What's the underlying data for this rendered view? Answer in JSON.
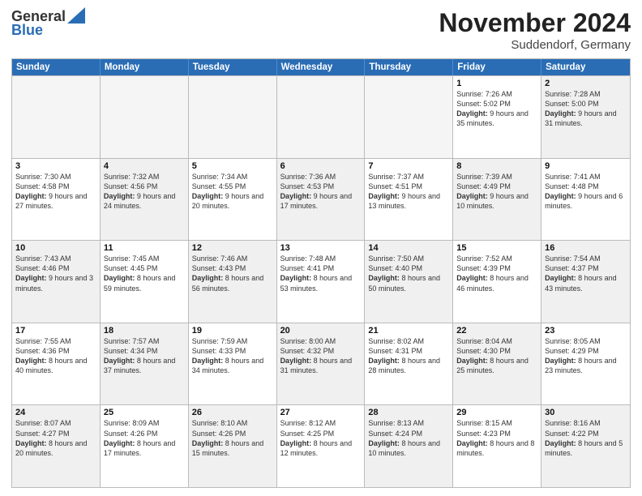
{
  "header": {
    "logo_general": "General",
    "logo_blue": "Blue",
    "month_title": "November 2024",
    "location": "Suddendorf, Germany"
  },
  "weekdays": [
    "Sunday",
    "Monday",
    "Tuesday",
    "Wednesday",
    "Thursday",
    "Friday",
    "Saturday"
  ],
  "rows": [
    [
      {
        "day": "",
        "info": "",
        "empty": true
      },
      {
        "day": "",
        "info": "",
        "empty": true
      },
      {
        "day": "",
        "info": "",
        "empty": true
      },
      {
        "day": "",
        "info": "",
        "empty": true
      },
      {
        "day": "",
        "info": "",
        "empty": true
      },
      {
        "day": "1",
        "info": "Sunrise: 7:26 AM\nSunset: 5:02 PM\nDaylight: 9 hours and 35 minutes."
      },
      {
        "day": "2",
        "info": "Sunrise: 7:28 AM\nSunset: 5:00 PM\nDaylight: 9 hours and 31 minutes.",
        "shaded": true
      }
    ],
    [
      {
        "day": "3",
        "info": "Sunrise: 7:30 AM\nSunset: 4:58 PM\nDaylight: 9 hours and 27 minutes."
      },
      {
        "day": "4",
        "info": "Sunrise: 7:32 AM\nSunset: 4:56 PM\nDaylight: 9 hours and 24 minutes.",
        "shaded": true
      },
      {
        "day": "5",
        "info": "Sunrise: 7:34 AM\nSunset: 4:55 PM\nDaylight: 9 hours and 20 minutes."
      },
      {
        "day": "6",
        "info": "Sunrise: 7:36 AM\nSunset: 4:53 PM\nDaylight: 9 hours and 17 minutes.",
        "shaded": true
      },
      {
        "day": "7",
        "info": "Sunrise: 7:37 AM\nSunset: 4:51 PM\nDaylight: 9 hours and 13 minutes."
      },
      {
        "day": "8",
        "info": "Sunrise: 7:39 AM\nSunset: 4:49 PM\nDaylight: 9 hours and 10 minutes.",
        "shaded": true
      },
      {
        "day": "9",
        "info": "Sunrise: 7:41 AM\nSunset: 4:48 PM\nDaylight: 9 hours and 6 minutes."
      }
    ],
    [
      {
        "day": "10",
        "info": "Sunrise: 7:43 AM\nSunset: 4:46 PM\nDaylight: 9 hours and 3 minutes.",
        "shaded": true
      },
      {
        "day": "11",
        "info": "Sunrise: 7:45 AM\nSunset: 4:45 PM\nDaylight: 8 hours and 59 minutes."
      },
      {
        "day": "12",
        "info": "Sunrise: 7:46 AM\nSunset: 4:43 PM\nDaylight: 8 hours and 56 minutes.",
        "shaded": true
      },
      {
        "day": "13",
        "info": "Sunrise: 7:48 AM\nSunset: 4:41 PM\nDaylight: 8 hours and 53 minutes."
      },
      {
        "day": "14",
        "info": "Sunrise: 7:50 AM\nSunset: 4:40 PM\nDaylight: 8 hours and 50 minutes.",
        "shaded": true
      },
      {
        "day": "15",
        "info": "Sunrise: 7:52 AM\nSunset: 4:39 PM\nDaylight: 8 hours and 46 minutes."
      },
      {
        "day": "16",
        "info": "Sunrise: 7:54 AM\nSunset: 4:37 PM\nDaylight: 8 hours and 43 minutes.",
        "shaded": true
      }
    ],
    [
      {
        "day": "17",
        "info": "Sunrise: 7:55 AM\nSunset: 4:36 PM\nDaylight: 8 hours and 40 minutes."
      },
      {
        "day": "18",
        "info": "Sunrise: 7:57 AM\nSunset: 4:34 PM\nDaylight: 8 hours and 37 minutes.",
        "shaded": true
      },
      {
        "day": "19",
        "info": "Sunrise: 7:59 AM\nSunset: 4:33 PM\nDaylight: 8 hours and 34 minutes."
      },
      {
        "day": "20",
        "info": "Sunrise: 8:00 AM\nSunset: 4:32 PM\nDaylight: 8 hours and 31 minutes.",
        "shaded": true
      },
      {
        "day": "21",
        "info": "Sunrise: 8:02 AM\nSunset: 4:31 PM\nDaylight: 8 hours and 28 minutes."
      },
      {
        "day": "22",
        "info": "Sunrise: 8:04 AM\nSunset: 4:30 PM\nDaylight: 8 hours and 25 minutes.",
        "shaded": true
      },
      {
        "day": "23",
        "info": "Sunrise: 8:05 AM\nSunset: 4:29 PM\nDaylight: 8 hours and 23 minutes."
      }
    ],
    [
      {
        "day": "24",
        "info": "Sunrise: 8:07 AM\nSunset: 4:27 PM\nDaylight: 8 hours and 20 minutes.",
        "shaded": true
      },
      {
        "day": "25",
        "info": "Sunrise: 8:09 AM\nSunset: 4:26 PM\nDaylight: 8 hours and 17 minutes."
      },
      {
        "day": "26",
        "info": "Sunrise: 8:10 AM\nSunset: 4:26 PM\nDaylight: 8 hours and 15 minutes.",
        "shaded": true
      },
      {
        "day": "27",
        "info": "Sunrise: 8:12 AM\nSunset: 4:25 PM\nDaylight: 8 hours and 12 minutes."
      },
      {
        "day": "28",
        "info": "Sunrise: 8:13 AM\nSunset: 4:24 PM\nDaylight: 8 hours and 10 minutes.",
        "shaded": true
      },
      {
        "day": "29",
        "info": "Sunrise: 8:15 AM\nSunset: 4:23 PM\nDaylight: 8 hours and 8 minutes."
      },
      {
        "day": "30",
        "info": "Sunrise: 8:16 AM\nSunset: 4:22 PM\nDaylight: 8 hours and 5 minutes.",
        "shaded": true
      }
    ]
  ]
}
